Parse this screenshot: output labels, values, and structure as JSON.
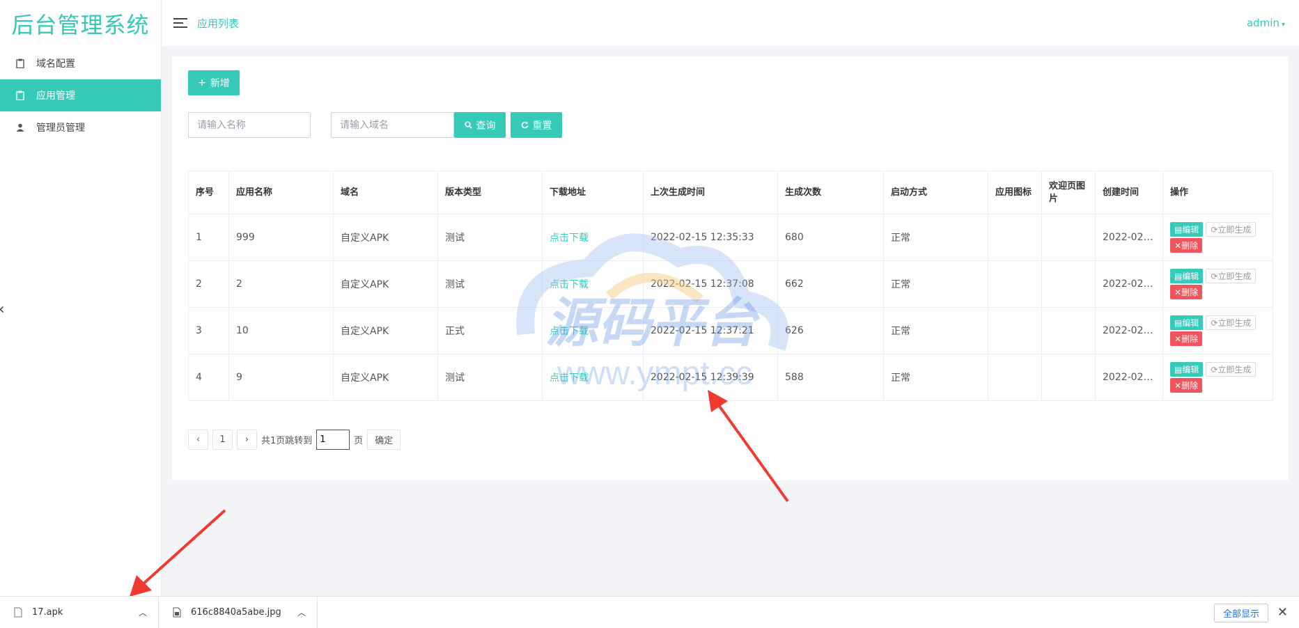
{
  "app": {
    "title": "后台管理系统"
  },
  "sidebar": {
    "items": [
      {
        "label": "域名配置",
        "icon": "clipboard-icon",
        "active": false
      },
      {
        "label": "应用管理",
        "icon": "clipboard-icon",
        "active": true
      },
      {
        "label": "管理员管理",
        "icon": "user-icon",
        "active": false
      }
    ]
  },
  "header": {
    "breadcrumb": "应用列表",
    "user": "admin"
  },
  "toolbar": {
    "add_label": "新增",
    "name_placeholder": "请输入名称",
    "domain_placeholder": "请输入域名",
    "query_label": "查询",
    "reset_label": "重置"
  },
  "table": {
    "headers": [
      "序号",
      "应用名称",
      "域名",
      "版本类型",
      "下载地址",
      "上次生成时间",
      "生成次数",
      "启动方式",
      "应用图标",
      "欢迎页图片",
      "创建时间",
      "操作"
    ],
    "rows": [
      {
        "no": "1",
        "name": "999",
        "domain": "自定义APK",
        "type": "测试",
        "download": "点击下载",
        "last_gen": "2022-02-15 12:35:33",
        "count": "680",
        "launch": "正常",
        "icon": "",
        "welcome": "",
        "created": "2022-02-..."
      },
      {
        "no": "2",
        "name": "2",
        "domain": "自定义APK",
        "type": "测试",
        "download": "点击下载",
        "last_gen": "2022-02-15 12:37:08",
        "count": "662",
        "launch": "正常",
        "icon": "",
        "welcome": "",
        "created": "2022-02-..."
      },
      {
        "no": "3",
        "name": "10",
        "domain": "自定义APK",
        "type": "正式",
        "download": "点击下载",
        "last_gen": "2022-02-15 12:37:21",
        "count": "626",
        "launch": "正常",
        "icon": "",
        "welcome": "",
        "created": "2022-02-..."
      },
      {
        "no": "4",
        "name": "9",
        "domain": "自定义APK",
        "type": "测试",
        "download": "点击下载",
        "last_gen": "2022-02-15 12:39:39",
        "count": "588",
        "launch": "正常",
        "icon": "",
        "welcome": "",
        "created": "2022-02-..."
      }
    ],
    "ops": {
      "edit": "编辑",
      "generate": "立即生成",
      "delete": "删除"
    }
  },
  "pagination": {
    "prev": "‹",
    "page": "1",
    "next": "›",
    "total_text": "共1页跳转到",
    "jump_value": "1",
    "page_unit": "页",
    "confirm": "确定"
  },
  "watermark": {
    "line1": "源码平台",
    "line2": "www.ympt.cc"
  },
  "downloads": {
    "items": [
      {
        "name": "17.apk",
        "icon": "file-icon"
      },
      {
        "name": "616c8840a5abe.jpg",
        "icon": "image-file-icon"
      }
    ],
    "show_all": "全部显示"
  },
  "colors": {
    "accent": "#36cbb9",
    "danger": "#f0545c",
    "annotation": "#f03a30"
  }
}
